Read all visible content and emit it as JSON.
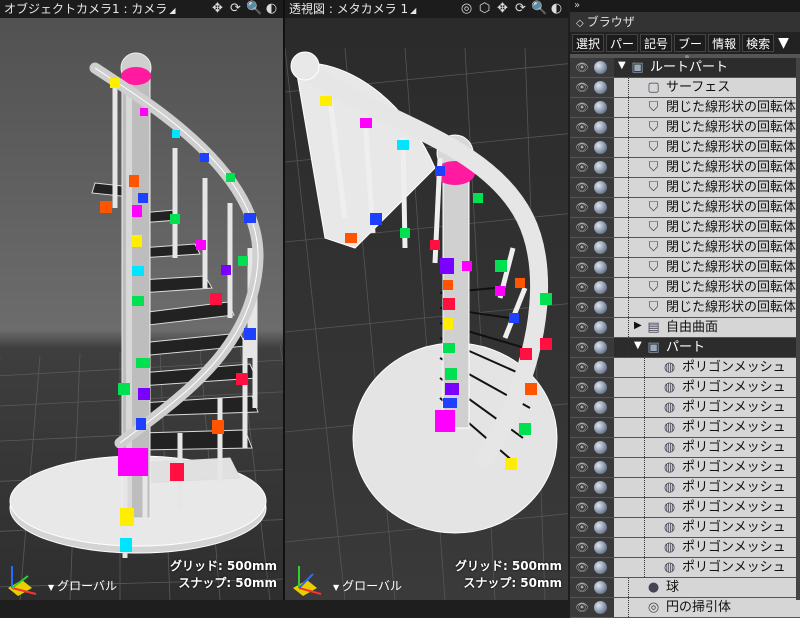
{
  "left_viewport": {
    "title": "オブジェクトカメラ1 : カメラ",
    "grid_label": "グリッド: 500mm",
    "snap_label": "スナップ: 50mm",
    "coord_label": "グローバル",
    "tool_icons": [
      "viewport-move-icon",
      "rotate-icon",
      "zoom-icon",
      "display-icon"
    ]
  },
  "right_viewport": {
    "title": "透視図 : メタカメラ 1",
    "grid_label": "グリッド: 500mm",
    "snap_label": "スナップ: 50mm",
    "coord_label": "グローバル",
    "tool_icons": [
      "target-icon",
      "cube-icon",
      "move-icon",
      "rotate-icon",
      "zoom-icon",
      "display-icon"
    ]
  },
  "browser": {
    "top_label": "»",
    "title": "ブラウザ",
    "tabs": [
      "選択",
      "パー",
      "記号",
      "ブー",
      "情報",
      "検索"
    ],
    "items": [
      {
        "label": "ルートパート",
        "level": 0,
        "icon": "part-icon",
        "expanded": true,
        "dark": true
      },
      {
        "label": "サーフェス",
        "level": 1,
        "icon": "surface-icon"
      },
      {
        "label": "閉じた線形状の回転体",
        "level": 1,
        "icon": "revolution-icon"
      },
      {
        "label": "閉じた線形状の回転体",
        "level": 1,
        "icon": "revolution-icon"
      },
      {
        "label": "閉じた線形状の回転体",
        "level": 1,
        "icon": "revolution-icon"
      },
      {
        "label": "閉じた線形状の回転体",
        "level": 1,
        "icon": "revolution-icon"
      },
      {
        "label": "閉じた線形状の回転体",
        "level": 1,
        "icon": "revolution-icon"
      },
      {
        "label": "閉じた線形状の回転体",
        "level": 1,
        "icon": "revolution-icon"
      },
      {
        "label": "閉じた線形状の回転体",
        "level": 1,
        "icon": "revolution-icon"
      },
      {
        "label": "閉じた線形状の回転体",
        "level": 1,
        "icon": "revolution-icon"
      },
      {
        "label": "閉じた線形状の回転体",
        "level": 1,
        "icon": "revolution-icon"
      },
      {
        "label": "閉じた線形状の回転体",
        "level": 1,
        "icon": "revolution-icon"
      },
      {
        "label": "閉じた線形状の回転体",
        "level": 1,
        "icon": "revolution-icon"
      },
      {
        "label": "自由曲面",
        "level": 1,
        "icon": "free-surface-icon",
        "expanded": false
      },
      {
        "label": "パート",
        "level": 1,
        "icon": "part-icon",
        "expanded": true,
        "dark": true
      },
      {
        "label": "ポリゴンメッシュ",
        "level": 2,
        "icon": "polygon-mesh-icon"
      },
      {
        "label": "ポリゴンメッシュ",
        "level": 2,
        "icon": "polygon-mesh-icon"
      },
      {
        "label": "ポリゴンメッシュ",
        "level": 2,
        "icon": "polygon-mesh-icon"
      },
      {
        "label": "ポリゴンメッシュ",
        "level": 2,
        "icon": "polygon-mesh-icon"
      },
      {
        "label": "ポリゴンメッシュ",
        "level": 2,
        "icon": "polygon-mesh-icon"
      },
      {
        "label": "ポリゴンメッシュ",
        "level": 2,
        "icon": "polygon-mesh-icon"
      },
      {
        "label": "ポリゴンメッシュ",
        "level": 2,
        "icon": "polygon-mesh-icon"
      },
      {
        "label": "ポリゴンメッシュ",
        "level": 2,
        "icon": "polygon-mesh-icon"
      },
      {
        "label": "ポリゴンメッシュ",
        "level": 2,
        "icon": "polygon-mesh-icon"
      },
      {
        "label": "ポリゴンメッシュ",
        "level": 2,
        "icon": "polygon-mesh-icon"
      },
      {
        "label": "ポリゴンメッシュ",
        "level": 2,
        "icon": "polygon-mesh-icon"
      },
      {
        "label": "球",
        "level": 1,
        "icon": "sphere-icon"
      },
      {
        "label": "円の掃引体",
        "level": 1,
        "icon": "sweep-icon"
      }
    ]
  },
  "colors": {
    "panel_bg": "#2a2a2a",
    "row_bg": "#d6d6d6",
    "selected_row_bg": "#2c2c2c",
    "marker_magenta": "#ff1aa0",
    "marker_palette": [
      "#ffee00",
      "#ff00ff",
      "#00e5ff",
      "#2040ff",
      "#00e050",
      "#ff5500",
      "#7a00ff",
      "#ff1040"
    ]
  }
}
